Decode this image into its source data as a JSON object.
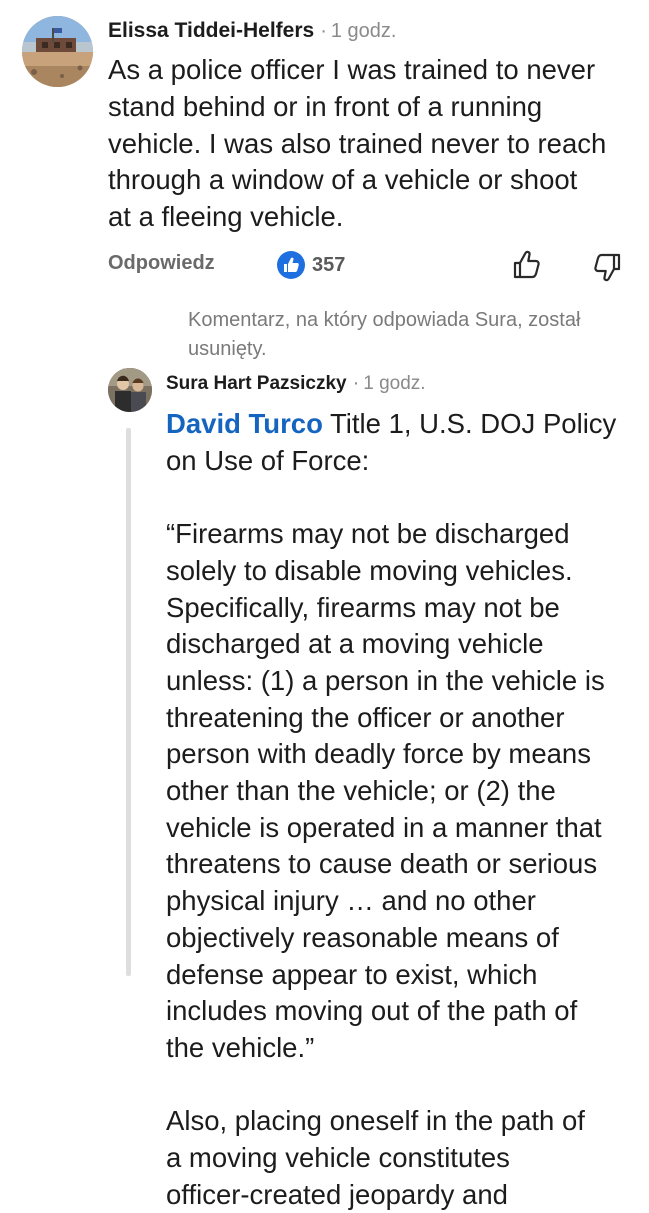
{
  "comments": [
    {
      "author": "Elissa Tiddei-Helfers",
      "separator": "·",
      "time": "1 godz.",
      "avatar_icon": "profile-photo-landscape",
      "text_lines": [
        "As a police officer I was trained to never",
        "stand behind or in front of a running",
        "vehicle. I was also trained never to reach",
        "through a window of a vehicle or shoot",
        "at a fleeing vehicle."
      ],
      "actions": {
        "reply_label": "Odpowiedz",
        "like_count": "357",
        "like_icon": "blue-thumbs-up-icon",
        "thumbs_up_icon": "thumbs-up-icon",
        "thumbs_down_icon": "thumbs-down-icon"
      }
    },
    {
      "deleted_parent_note": "Komentarz, na który odpowiada Sura, został usunięty.",
      "author": "Sura Hart Pazsiczky",
      "separator": "·",
      "time": "1 godz.",
      "avatar_icon": "profile-photo-people",
      "mention": "David Turco",
      "text_lines": [
        " Title 1, U.S. DOJ Policy",
        "on Use of Force:",
        "",
        "“Firearms may not be discharged",
        "solely to disable moving vehicles.",
        "Specifically, firearms may not be",
        "discharged at a moving vehicle",
        "unless: (1) a person in the vehicle is",
        "threatening the officer or another",
        "person with deadly force by means",
        "other than the vehicle; or (2) the",
        "vehicle is operated in a manner that",
        "threatens to cause death or serious",
        "physical injury … and no other",
        "objectively reasonable means of",
        "defense appear to exist, which",
        "includes moving out of the path of",
        "the vehicle.”",
        "",
        "Also, placing oneself in the path of",
        "a moving vehicle constitutes",
        "officer-created jeopardy and"
      ]
    }
  ],
  "colors": {
    "mention": "#1565c0",
    "like_blue": "#1e6fe0",
    "meta_gray": "#8a8a8a",
    "thread_bar": "#dedede"
  }
}
